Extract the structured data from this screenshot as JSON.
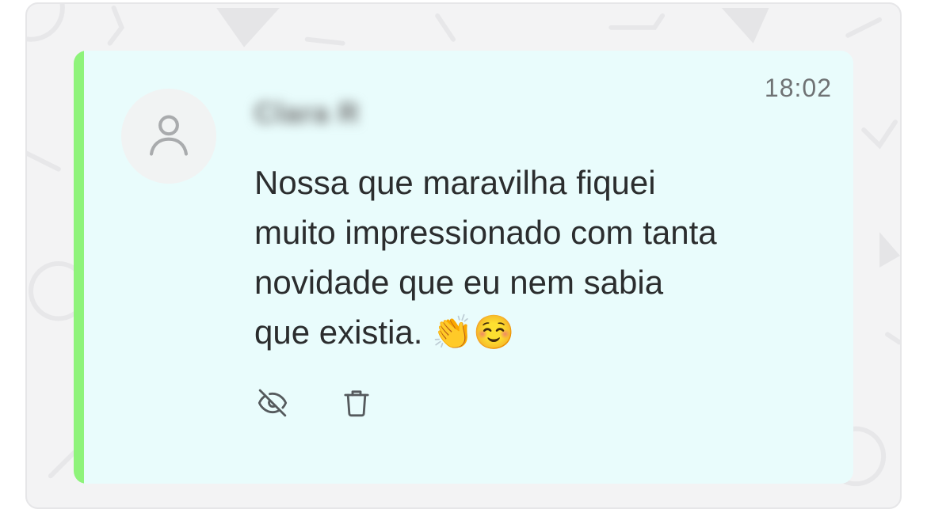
{
  "message": {
    "sender_name": "Clara R",
    "timestamp": "18:02",
    "text": "Nossa que maravilha fiquei\nmuito impressionado com tanta\nnovidade que eu nem sabia\nque existia. 👏☺️"
  },
  "icons": {
    "avatar": "user-icon",
    "hide": "eye-off-icon",
    "delete": "trash-icon"
  },
  "colors": {
    "accent": "#8ef37a",
    "card_background": "#e9fcfc",
    "panel_background": "#f3f3f4"
  }
}
